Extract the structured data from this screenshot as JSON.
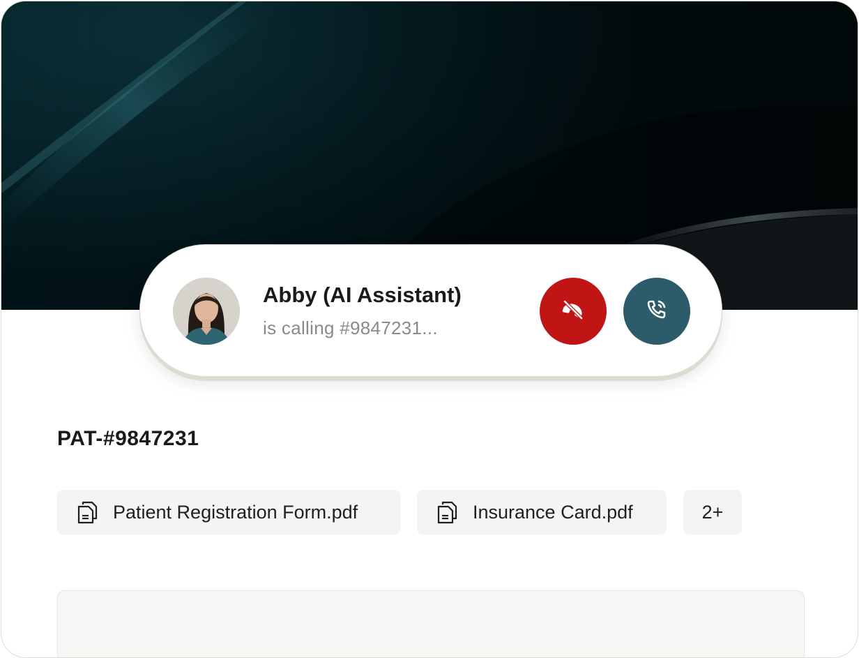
{
  "caller": {
    "name": "Abby (AI Assistant)",
    "status": "is calling #9847231..."
  },
  "actions": {
    "decline_icon": "phone-off-icon",
    "accept_icon": "phone-call-icon",
    "decline_color": "#c11414",
    "accept_color": "#2c5b6a"
  },
  "patient": {
    "id": "PAT-#9847231"
  },
  "attachments": [
    {
      "name": "Patient Registration Form.pdf",
      "icon": "document-icon"
    },
    {
      "name": "Insurance Card.pdf",
      "icon": "document-icon"
    }
  ],
  "attachments_more": "2+"
}
